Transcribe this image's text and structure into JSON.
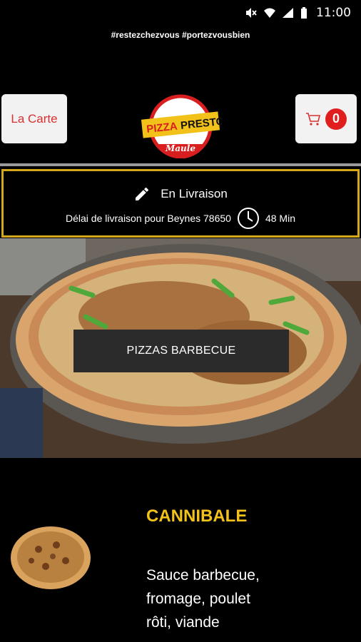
{
  "status_bar": {
    "time": "11:00"
  },
  "banner": {
    "hashtag": "#restezchezvous #portezvousbien"
  },
  "header": {
    "menu_button": "La Carte",
    "logo": {
      "line1": "PIZZA",
      "line2": "PRESTO",
      "line3": "Maule"
    },
    "cart_count": "0"
  },
  "delivery": {
    "mode": "En Livraison",
    "info": "Délai de livraison pour Beynes 78650",
    "time": "48 Min"
  },
  "category": {
    "title": "PIZZAS BARBECUE"
  },
  "product": {
    "name": "CANNIBALE",
    "description": "Sauce barbecue, fromage, poulet rôti, viande"
  },
  "colors": {
    "accent": "#d4a81a",
    "title": "#f2c21b",
    "badge": "#e01e1e",
    "menu_text": "#d83030"
  }
}
